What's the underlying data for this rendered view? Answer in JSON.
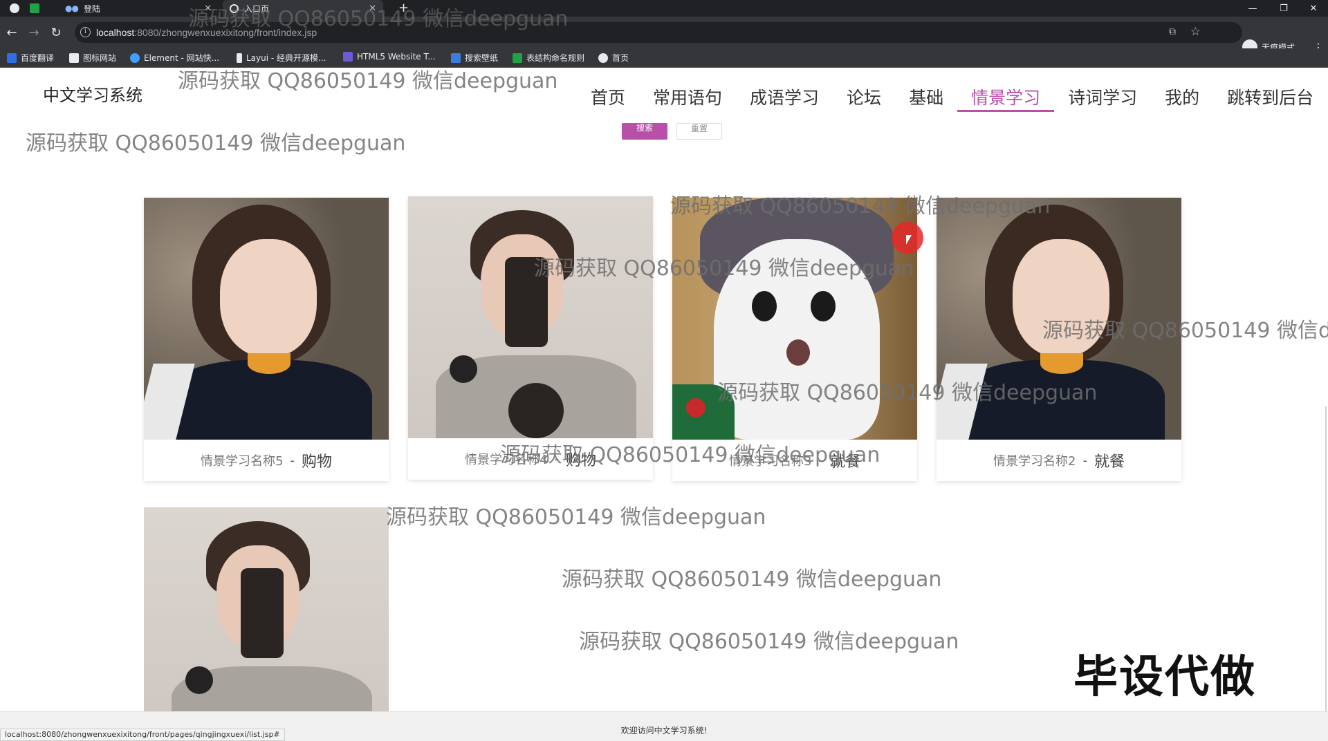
{
  "browser": {
    "tabs": [
      {
        "label": "登陆"
      },
      {
        "label": "入口页"
      }
    ],
    "url_host": "localhost",
    "url_path": ":8080/zhongwenxuexixitong/front/index.jsp",
    "profile_label": "无痕模式",
    "bookmarks": [
      {
        "label": "百度翻译",
        "color": "#2f6ee8"
      },
      {
        "label": "图标网站",
        "color": "#e8eaed"
      },
      {
        "label": "Element - 网站快...",
        "color": "#409eff"
      },
      {
        "label": "Layui - 经典开源模...",
        "color": "#e8eaed"
      },
      {
        "label": "HTML5 Website T...",
        "color": "#6b5bd6"
      },
      {
        "label": "搜索壁纸",
        "color": "#3b7ddd"
      },
      {
        "label": "表结构命名规则",
        "color": "#1ea446"
      },
      {
        "label": "首页",
        "color": "#e8eaed"
      }
    ],
    "status_url": "localhost:8080/zhongwenxuexixitong/front/pages/qingjingxuexi/list.jsp#"
  },
  "site": {
    "title": "中文学习系统",
    "nav": [
      {
        "label": "首页",
        "active": false
      },
      {
        "label": "常用语句",
        "active": false
      },
      {
        "label": "成语学习",
        "active": false
      },
      {
        "label": "论坛",
        "active": false
      },
      {
        "label": "基础",
        "active": false
      },
      {
        "label": "情景学习",
        "active": true
      },
      {
        "label": "诗词学习",
        "active": false
      },
      {
        "label": "我的",
        "active": false
      },
      {
        "label": "跳转到后台",
        "active": false
      }
    ],
    "search_label": "搜索",
    "reset_label": "重置",
    "accent_color": "#b84fa8",
    "cards": [
      {
        "name": "情景学习名称5",
        "sep": "-",
        "type": "购物",
        "image": "girl-portrait"
      },
      {
        "name": "情景学习名称4",
        "sep": "-",
        "type": "购物",
        "image": "boy-selfie"
      },
      {
        "name": "情景学习名称3",
        "sep": "-",
        "type": "就餐",
        "image": "cat-photo"
      },
      {
        "name": "情景学习名称2",
        "sep": "-",
        "type": "就餐",
        "image": "girl-portrait"
      },
      {
        "name": "",
        "sep": "",
        "type": "",
        "image": "boy-selfie"
      }
    ],
    "footer_text": "欢迎访问中文学习系统!"
  },
  "overlay": {
    "watermark_text": "源码获取 QQ86050149 微信deepguan",
    "watermark_cut": "源码获取 QQ86050149 微信d",
    "badge_text": "毕设代做"
  }
}
